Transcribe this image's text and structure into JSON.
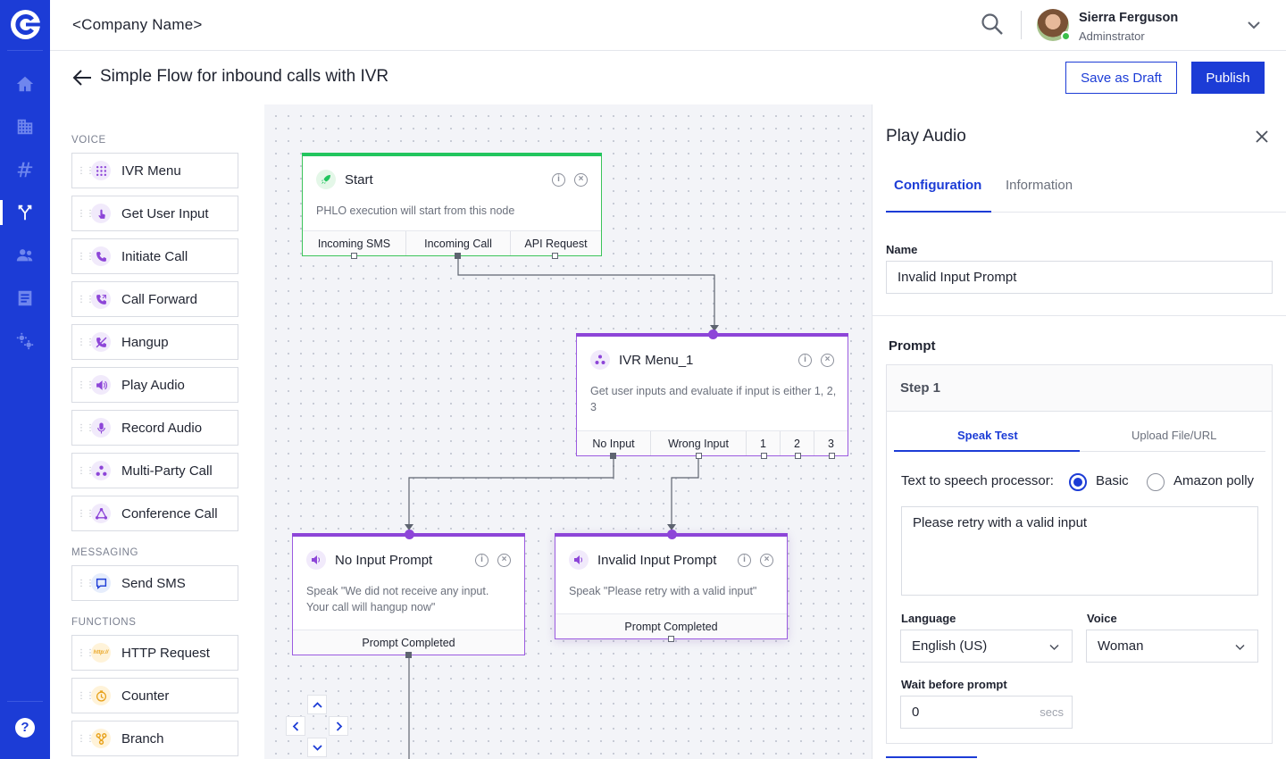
{
  "topbar": {
    "company": "<Company Name>",
    "user_name": "Sierra Ferguson",
    "user_role": "Adminstrator"
  },
  "subheader": {
    "title": "Simple Flow for inbound calls with IVR",
    "save_draft": "Save as Draft",
    "publish": "Publish"
  },
  "palette": {
    "voice_heading": "VOICE",
    "messaging_heading": "MESSAGING",
    "functions_heading": "FUNCTIONS",
    "voice": [
      "IVR Menu",
      "Get User Input",
      "Initiate Call",
      "Call Forward",
      "Hangup",
      "Play Audio",
      "Record Audio",
      "Multi-Party Call",
      "Conference Call"
    ],
    "messaging": [
      "Send SMS"
    ],
    "functions": [
      "HTTP Request",
      "Counter",
      "Branch"
    ],
    "http_badge": "http://"
  },
  "nodes": {
    "start": {
      "title": "Start",
      "desc": "PHLO execution will start from this node",
      "ports": [
        "Incoming SMS",
        "Incoming Call",
        "API Request"
      ]
    },
    "ivr": {
      "title": "IVR Menu_1",
      "desc": "Get user inputs and evaluate if input is either 1, 2, 3",
      "ports": [
        "No Input",
        "Wrong Input",
        "1",
        "2",
        "3"
      ]
    },
    "noinput": {
      "title": "No Input Prompt",
      "desc": "Speak \"We did not receive any input. Your call will hangup now\"",
      "port": "Prompt Completed"
    },
    "invalid": {
      "title": "Invalid Input Prompt",
      "desc": "Speak \"Please retry with a valid input\"",
      "port": "Prompt Completed"
    }
  },
  "panel": {
    "title": "Play Audio",
    "tabs": [
      "Configuration",
      "Information"
    ],
    "name_label": "Name",
    "name_value": "Invalid Input Prompt",
    "prompt_label": "Prompt",
    "step": "Step 1",
    "subtabs": [
      "Speak Test",
      "Upload File/URL"
    ],
    "tts_label": "Text to speech processor:",
    "tts_options": [
      "Basic",
      "Amazon polly"
    ],
    "tts_selected": "Basic",
    "prompt_text": "Please retry with a valid input",
    "language_label": "Language",
    "language_value": "English (US)",
    "voice_label": "Voice",
    "voice_value": "Woman",
    "wait_label": "Wait before prompt",
    "wait_value": "0",
    "wait_unit": "secs"
  },
  "colors": {
    "brand": "#1c3cd6",
    "start_accent": "#22c55e",
    "node_accent": "#8d45d8"
  }
}
